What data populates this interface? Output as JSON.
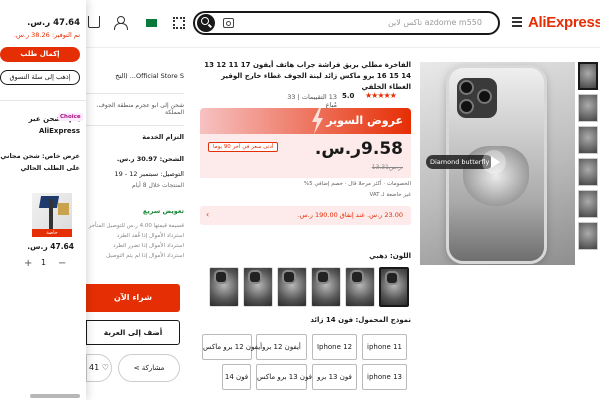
{
  "header": {
    "logo": "AliExpress",
    "search_text": "azdome m550 تاكس لاين",
    "icons": [
      "menu-icon",
      "search-icon",
      "camera-icon",
      "qr-icon",
      "flag-icon",
      "user-icon",
      "cart-icon"
    ]
  },
  "cart_panel": {
    "total": "47.64 ر.س.",
    "savings": "تم التوفير: 38.26 ر.س.",
    "checkout_label": "إكمال طلب",
    "go_cart_label": "إذهب إلى سلة التسوق",
    "shipping_title": "يتم الشحن عبر",
    "shipping_brand": "AliExpress",
    "choice_badge": "Choice",
    "offer_text": "عرض خاص: شحن مجاني على الطلب الحالي",
    "thumb_tag": "خاصة",
    "item_price": "47.64 ر.س.",
    "quantity": "1",
    "plus": "+",
    "minus": "−"
  },
  "side": {
    "store_name": "Official Store S... (التخ",
    "store_note": "شحن",
    "ship_to_label": "شحن إلى",
    "ship_to_value": "ابو عجرم منطقة الجوف، المملكة",
    "commitment": "التزام الخدمة",
    "shipping_fee": "الشحن: 30.97 ر.س.",
    "delivery": "التوصيل: سبتمبر 12 - 19",
    "delivery_sub": "المنتجات خلال 8 أيام",
    "refund_title": "تعويض سريع",
    "refund_lines": [
      "قسيمة قيمتها 4.00 ر.س للتوصيل المتأخر",
      "استرداد الأموال إذا فُقد الطرد",
      "استرداد الأموال إذا تضرر الطرد",
      "استرداد الأموال إذا لم يتم التوصيل"
    ],
    "buy_now": "شراء الآن",
    "add_to_cart": "أضف إلى العربة",
    "share": "مشاركة",
    "wishlist_count": "41"
  },
  "product": {
    "title": "الفاخرة مطلي بريق فراشة جراب هاتف أيفون 17 11 12 13 14 15 16 برو ماكس زائد لينة الجوف غطاء خارج الوقير الغطاء الخلفي",
    "rating": "5.0",
    "stars": "★★★★★",
    "reviews": "13 التقييمات | 33 مُباع",
    "superdeal_label": "عروض السوبر",
    "price": "9.58ر.س.",
    "price_badge": "أدنى سعر في آخر 90 يوما",
    "original_price": "13.31ر.س.",
    "discount_line": "الخصومات · أكثر مرحلا قال · خصم إضافي 5%",
    "tax_line": "غير خاضعة لـ VAT",
    "coupon_text": "23.00 ر.س. عند إنفاق 190.00 ر.س.",
    "coupon_arrow": "‹",
    "color_label": "اللون: ذهبي",
    "model_label": "نموذج المحمول: فون 14 زائد",
    "models": [
      "iphone 11",
      "Iphone 12",
      "أيفون 12 برو",
      "أيفون 12 برو ماكس",
      "iphone 13",
      "فون 13 برو",
      "فون 13 برو ماكس",
      "فون 14"
    ],
    "video_chip": "Diamond butterfly"
  }
}
